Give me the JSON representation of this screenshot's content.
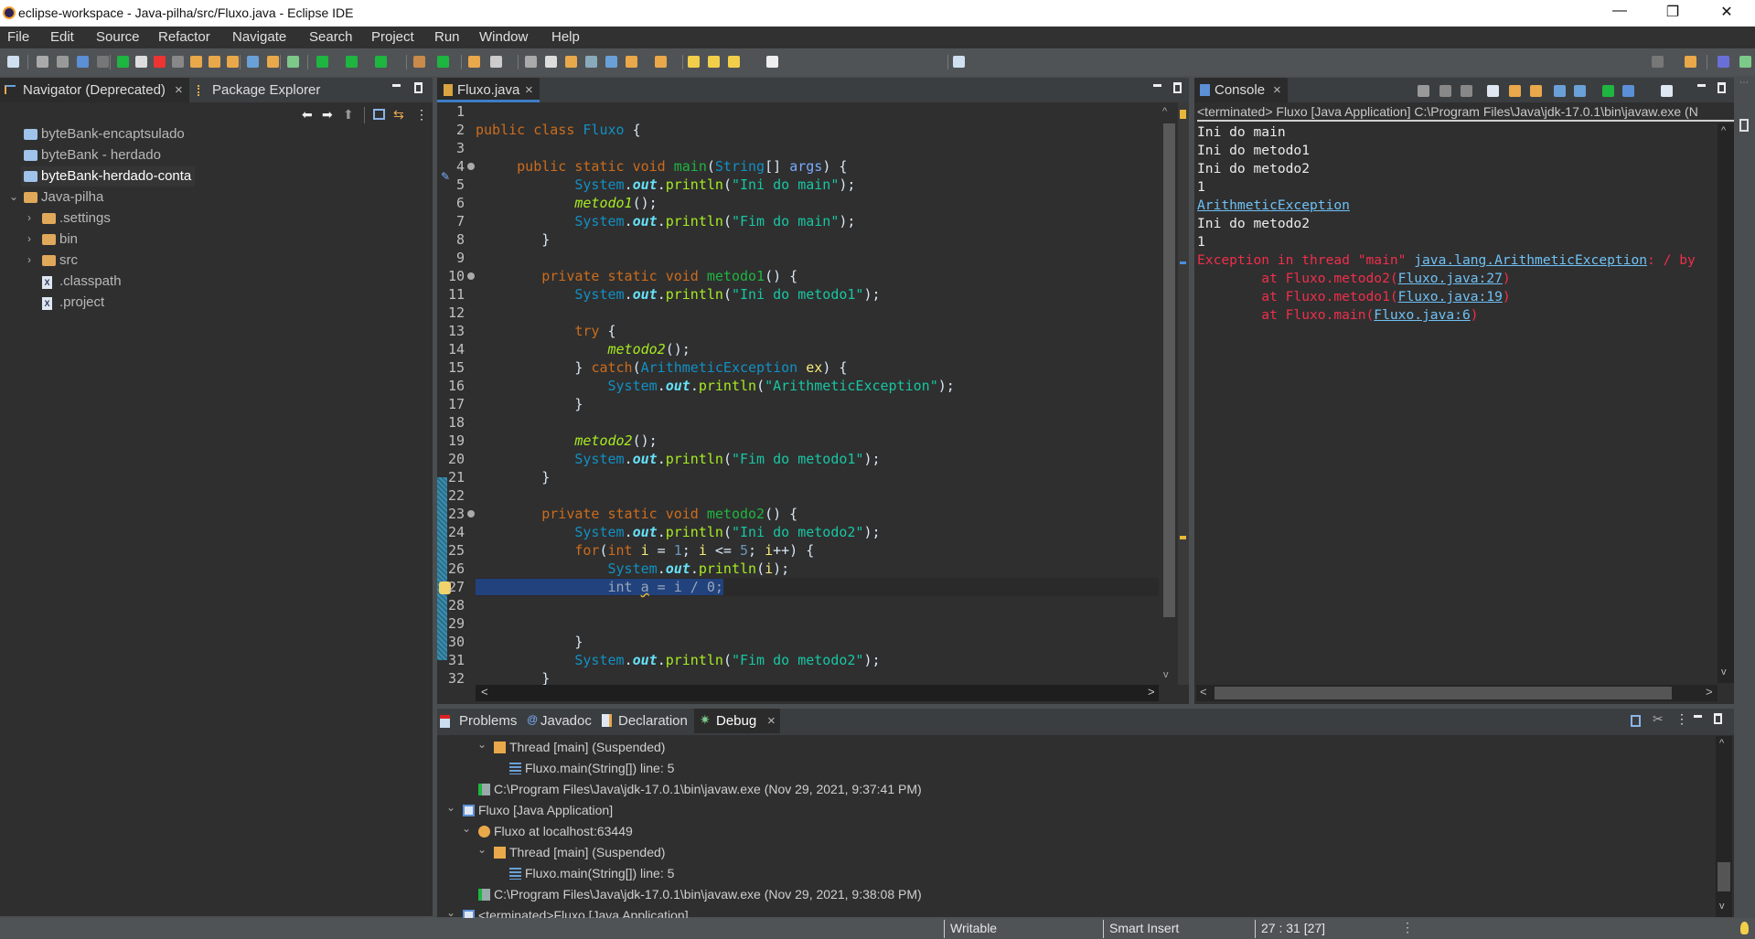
{
  "window": {
    "title": "eclipse-workspace - Java-pilha/src/Fluxo.java - Eclipse IDE",
    "minimize": "—",
    "maximize": "❐",
    "close": "✕"
  },
  "menu": [
    "File",
    "Edit",
    "Source",
    "Refactor",
    "Navigate",
    "Search",
    "Project",
    "Run",
    "Window",
    "Help"
  ],
  "navigator": {
    "tabs": [
      {
        "label": "Navigator (Deprecated)",
        "close": "×"
      },
      {
        "label": "Package Explorer"
      }
    ],
    "items": [
      {
        "label": "byteBank-encaptsulado",
        "icon": "project-closed-icon",
        "level": 0
      },
      {
        "label": "byteBank - herdado",
        "icon": "project-closed-icon",
        "level": 0
      },
      {
        "label": "byteBank-herdado-conta",
        "icon": "project-closed-icon",
        "level": 0,
        "selected": true
      },
      {
        "label": "Java-pilha",
        "icon": "java-project-icon",
        "level": 0,
        "expanded": true
      },
      {
        "label": ".settings",
        "icon": "folder-icon",
        "level": 1,
        "collapsed": true
      },
      {
        "label": "bin",
        "icon": "folder-icon",
        "level": 1,
        "collapsed": true
      },
      {
        "label": "src",
        "icon": "folder-icon",
        "level": 1,
        "collapsed": true
      },
      {
        "label": ".classpath",
        "icon": "xml-file-icon",
        "level": 1
      },
      {
        "label": ".project",
        "icon": "xml-file-icon",
        "level": 1
      }
    ]
  },
  "editor": {
    "tab": {
      "label": "Fluxo.java",
      "close": "×"
    },
    "current_line": 27,
    "lines": [
      [],
      [
        [
          "kw",
          "public"
        ],
        [
          "plain",
          " "
        ],
        [
          "kw",
          "class"
        ],
        [
          "plain",
          " "
        ],
        [
          "type",
          "Fluxo"
        ],
        [
          "plain",
          " {"
        ]
      ],
      [],
      [
        [
          "plain",
          "     "
        ],
        [
          "kw",
          "public"
        ],
        [
          "plain",
          " "
        ],
        [
          "kw",
          "static"
        ],
        [
          "plain",
          " "
        ],
        [
          "kw",
          "void"
        ],
        [
          "plain",
          " "
        ],
        [
          "mdecl",
          "main"
        ],
        [
          "plain",
          "("
        ],
        [
          "type",
          "String"
        ],
        [
          "plain",
          "[] "
        ],
        [
          "param",
          "args"
        ],
        [
          "plain",
          ") {"
        ]
      ],
      [
        [
          "plain",
          "            "
        ],
        [
          "type",
          "System"
        ],
        [
          "plain",
          "."
        ],
        [
          "field",
          "out"
        ],
        [
          "plain",
          "."
        ],
        [
          "call",
          "println"
        ],
        [
          "plain",
          "("
        ],
        [
          "str",
          "\"Ini do main\""
        ],
        [
          "plain",
          ");"
        ]
      ],
      [
        [
          "plain",
          "            "
        ],
        [
          "calli",
          "metodo1"
        ],
        [
          "plain",
          "();"
        ]
      ],
      [
        [
          "plain",
          "            "
        ],
        [
          "type",
          "System"
        ],
        [
          "plain",
          "."
        ],
        [
          "field",
          "out"
        ],
        [
          "plain",
          "."
        ],
        [
          "call",
          "println"
        ],
        [
          "plain",
          "("
        ],
        [
          "str",
          "\"Fim do main\""
        ],
        [
          "plain",
          ");"
        ]
      ],
      [
        [
          "plain",
          "        }"
        ]
      ],
      [],
      [
        [
          "plain",
          "        "
        ],
        [
          "kw",
          "private"
        ],
        [
          "plain",
          " "
        ],
        [
          "kw",
          "static"
        ],
        [
          "plain",
          " "
        ],
        [
          "kw",
          "void"
        ],
        [
          "plain",
          " "
        ],
        [
          "mdecl",
          "metodo1"
        ],
        [
          "plain",
          "() {"
        ]
      ],
      [
        [
          "plain",
          "            "
        ],
        [
          "type",
          "System"
        ],
        [
          "plain",
          "."
        ],
        [
          "field",
          "out"
        ],
        [
          "plain",
          "."
        ],
        [
          "call",
          "println"
        ],
        [
          "plain",
          "("
        ],
        [
          "str",
          "\"Ini do metodo1\""
        ],
        [
          "plain",
          ");"
        ]
      ],
      [],
      [
        [
          "plain",
          "            "
        ],
        [
          "kw",
          "try"
        ],
        [
          "plain",
          " {"
        ]
      ],
      [
        [
          "plain",
          "                "
        ],
        [
          "calli",
          "metodo2"
        ],
        [
          "plain",
          "();"
        ]
      ],
      [
        [
          "plain",
          "            } "
        ],
        [
          "kw",
          "catch"
        ],
        [
          "plain",
          "("
        ],
        [
          "type",
          "ArithmeticException"
        ],
        [
          "plain",
          " "
        ],
        [
          "local",
          "ex"
        ],
        [
          "plain",
          ") {"
        ]
      ],
      [
        [
          "plain",
          "                "
        ],
        [
          "type",
          "System"
        ],
        [
          "plain",
          "."
        ],
        [
          "field",
          "out"
        ],
        [
          "plain",
          "."
        ],
        [
          "call",
          "println"
        ],
        [
          "plain",
          "("
        ],
        [
          "str",
          "\"ArithmeticException\""
        ],
        [
          "plain",
          ");"
        ]
      ],
      [
        [
          "plain",
          "            }"
        ]
      ],
      [],
      [
        [
          "plain",
          "            "
        ],
        [
          "calli",
          "metodo2"
        ],
        [
          "plain",
          "();"
        ]
      ],
      [
        [
          "plain",
          "            "
        ],
        [
          "type",
          "System"
        ],
        [
          "plain",
          "."
        ],
        [
          "field",
          "out"
        ],
        [
          "plain",
          "."
        ],
        [
          "call",
          "println"
        ],
        [
          "plain",
          "("
        ],
        [
          "str",
          "\"Fim do metodo1\""
        ],
        [
          "plain",
          ");"
        ]
      ],
      [
        [
          "plain",
          "        }"
        ]
      ],
      [],
      [
        [
          "plain",
          "        "
        ],
        [
          "kw",
          "private"
        ],
        [
          "plain",
          " "
        ],
        [
          "kw",
          "static"
        ],
        [
          "plain",
          " "
        ],
        [
          "kw",
          "void"
        ],
        [
          "plain",
          " "
        ],
        [
          "mdecl",
          "metodo2"
        ],
        [
          "plain",
          "() {"
        ]
      ],
      [
        [
          "plain",
          "            "
        ],
        [
          "type",
          "System"
        ],
        [
          "plain",
          "."
        ],
        [
          "field",
          "out"
        ],
        [
          "plain",
          "."
        ],
        [
          "call",
          "println"
        ],
        [
          "plain",
          "("
        ],
        [
          "str",
          "\"Ini do metodo2\""
        ],
        [
          "plain",
          ");"
        ]
      ],
      [
        [
          "plain",
          "            "
        ],
        [
          "kw",
          "for"
        ],
        [
          "plain",
          "("
        ],
        [
          "kw",
          "int"
        ],
        [
          "plain",
          " "
        ],
        [
          "local",
          "i"
        ],
        [
          "plain",
          " = "
        ],
        [
          "num",
          "1"
        ],
        [
          "plain",
          "; "
        ],
        [
          "local",
          "i"
        ],
        [
          "plain",
          " <= "
        ],
        [
          "num",
          "5"
        ],
        [
          "plain",
          "; "
        ],
        [
          "local",
          "i"
        ],
        [
          "plain",
          "++) {"
        ]
      ],
      [
        [
          "plain",
          "                "
        ],
        [
          "type",
          "System"
        ],
        [
          "plain",
          "."
        ],
        [
          "field",
          "out"
        ],
        [
          "plain",
          "."
        ],
        [
          "call",
          "println"
        ],
        [
          "plain",
          "("
        ],
        [
          "local",
          "i"
        ],
        [
          "plain",
          ");"
        ]
      ],
      [
        [
          "sel",
          "                int "
        ],
        [
          "sel",
          "a"
        ],
        [
          "sel",
          " = i / 0;"
        ]
      ],
      [],
      [],
      [
        [
          "plain",
          "            }"
        ]
      ],
      [
        [
          "plain",
          "            "
        ],
        [
          "type",
          "System"
        ],
        [
          "plain",
          "."
        ],
        [
          "field",
          "out"
        ],
        [
          "plain",
          "."
        ],
        [
          "call",
          "println"
        ],
        [
          "plain",
          "("
        ],
        [
          "str",
          "\"Fim do metodo2\""
        ],
        [
          "plain",
          ");"
        ]
      ],
      [
        [
          "plain",
          "        }"
        ]
      ]
    ]
  },
  "console": {
    "tab": {
      "label": "Console",
      "close": "×"
    },
    "header": "<terminated> Fluxo [Java Application] C:\\Program Files\\Java\\jdk-17.0.1\\bin\\javaw.exe  (N",
    "lines": [
      [
        [
          "cnorm",
          "Ini do main"
        ]
      ],
      [
        [
          "cnorm",
          "Ini do metodo1"
        ]
      ],
      [
        [
          "cnorm",
          "Ini do metodo2"
        ]
      ],
      [
        [
          "cnorm",
          "1"
        ]
      ],
      [
        [
          "clink",
          "ArithmeticException"
        ]
      ],
      [
        [
          "cnorm",
          "Ini do metodo2"
        ]
      ],
      [
        [
          "cnorm",
          "1"
        ]
      ],
      [
        [
          "cerr",
          "Exception in thread \"main\" "
        ],
        [
          "clink",
          "java.lang.ArithmeticException"
        ],
        [
          "cerr",
          ": / by"
        ]
      ],
      [
        [
          "cerr",
          "        at Fluxo.metodo2("
        ],
        [
          "clink",
          "Fluxo.java:27"
        ],
        [
          "cerr",
          ")"
        ]
      ],
      [
        [
          "cerr",
          "        at Fluxo.metodo1("
        ],
        [
          "clink",
          "Fluxo.java:19"
        ],
        [
          "cerr",
          ")"
        ]
      ],
      [
        [
          "cerr",
          "        at Fluxo.main("
        ],
        [
          "clink",
          "Fluxo.java:6"
        ],
        [
          "cerr",
          ")"
        ]
      ]
    ]
  },
  "bottom": {
    "tabs": [
      {
        "label": "Problems"
      },
      {
        "label": "Javadoc"
      },
      {
        "label": "Declaration"
      },
      {
        "label": "Debug",
        "close": "×",
        "active": true
      }
    ],
    "debug_tree": [
      {
        "level": 2,
        "chevron": "⌄",
        "icon": "thread-icon",
        "label": "Thread [main] (Suspended)"
      },
      {
        "level": 3,
        "icon": "stack-frame-icon",
        "label": "Fluxo.main(String[]) line: 5"
      },
      {
        "level": 1,
        "icon": "process-icon",
        "label": "C:\\Program Files\\Java\\jdk-17.0.1\\bin\\javaw.exe (Nov 29, 2021, 9:37:41 PM)"
      },
      {
        "level": 0,
        "chevron": "⌄",
        "icon": "java-app-icon",
        "label": "Fluxo [Java Application]"
      },
      {
        "level": 1,
        "chevron": "⌄",
        "icon": "debug-target-icon",
        "label": "Fluxo at localhost:63449"
      },
      {
        "level": 2,
        "chevron": "⌄",
        "icon": "thread-icon",
        "label": "Thread [main] (Suspended)"
      },
      {
        "level": 3,
        "icon": "stack-frame-icon",
        "label": "Fluxo.main(String[]) line: 5"
      },
      {
        "level": 1,
        "icon": "process-icon",
        "label": "C:\\Program Files\\Java\\jdk-17.0.1\\bin\\javaw.exe (Nov 29, 2021, 9:38:08 PM)"
      },
      {
        "level": 0,
        "chevron": "⌄",
        "icon": "java-app-icon",
        "label": "<terminated>Fluxo [Java Application]"
      }
    ]
  },
  "status": {
    "writable": "Writable",
    "insert_mode": "Smart Insert",
    "position": "27 : 31 [27]"
  },
  "colors": {
    "selection": "#21427d",
    "keyword": "#cc6c1d",
    "string": "#17c6a3",
    "error": "#ef2f4b",
    "link": "#6fc1f5"
  }
}
